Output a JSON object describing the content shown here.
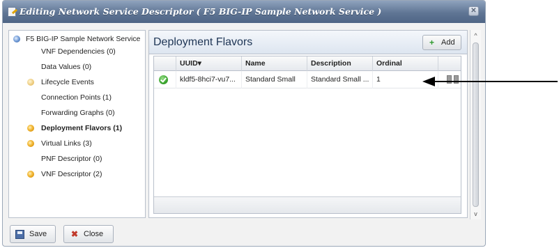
{
  "dialog": {
    "title": "Editing Network Service Descriptor ( F5 BIG-IP Sample Network Service )",
    "close_glyph": "✕"
  },
  "tree": {
    "items": [
      {
        "label": "F5 BIG-IP Sample Network Service",
        "icon": "blue-dot-icon"
      },
      {
        "label": "VNF Dependencies (0)",
        "icon": ""
      },
      {
        "label": "Data Values (0)",
        "icon": ""
      },
      {
        "label": "Lifecycle Events",
        "icon": "orange-dot-icon"
      },
      {
        "label": "Connection Points (1)",
        "icon": ""
      },
      {
        "label": "Forwarding Graphs (0)",
        "icon": ""
      },
      {
        "label": "Deployment Flavors (1)",
        "icon": "orange-dot-icon",
        "selected": true
      },
      {
        "label": "Virtual Links (3)",
        "icon": "orange-dot-icon"
      },
      {
        "label": "PNF Descriptor (0)",
        "icon": ""
      },
      {
        "label": "VNF Descriptor (2)",
        "icon": "orange-dot-icon"
      }
    ]
  },
  "panel": {
    "title": "Deployment Flavors",
    "add_label": "Add",
    "add_icon": "+",
    "columns": [
      "UUID▾",
      "Name",
      "Description",
      "Ordinal"
    ],
    "rows": [
      {
        "status_icon": "check-circle-icon",
        "uuid": "kldf5-8hci7-vu7...",
        "name": "Standard Small",
        "description": "Standard Small ...",
        "ordinal": "1"
      }
    ]
  },
  "scrollbar": {
    "up": "^",
    "down": "v"
  },
  "footer": {
    "save_label": "Save",
    "close_label": "Close",
    "close_icon": "✖"
  },
  "colors": {
    "title_bar": "#5f7594",
    "accent_check": "#3aa52e",
    "add_plus": "#2e9a2e",
    "close_x": "#c0392b"
  }
}
